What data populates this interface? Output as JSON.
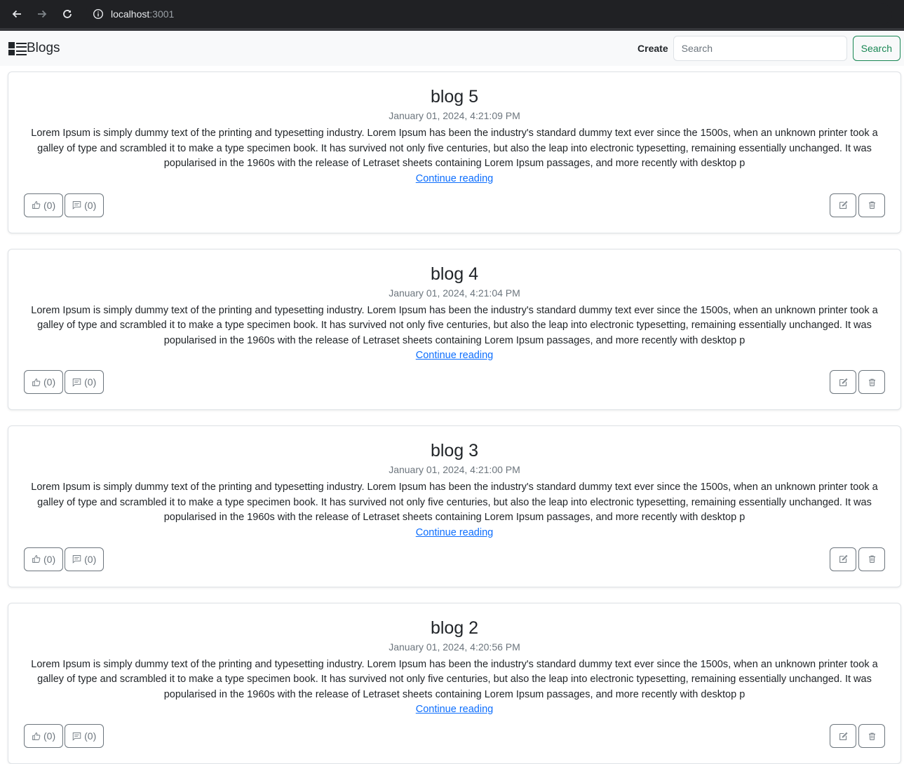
{
  "browser": {
    "url_host": "localhost",
    "url_port": ":3001",
    "icons": [
      "back-icon",
      "forward-icon",
      "reload-icon",
      "info-icon"
    ]
  },
  "navbar": {
    "brand": "Blogs",
    "create_label": "Create",
    "search_placeholder": "Search",
    "search_button": "Search",
    "colors": {
      "search_accent": "#198754",
      "link": "#0d6efd"
    }
  },
  "posts": [
    {
      "title": "blog 5",
      "date": "January 01, 2024, 4:21:09 PM",
      "excerpt": "Lorem Ipsum is simply dummy text of the printing and typesetting industry. Lorem Ipsum has been the industry's standard dummy text ever since the 1500s, when an unknown printer took a galley of type and scrambled it to make a type specimen book. It has survived not only five centuries, but also the leap into electronic typesetting, remaining essentially unchanged. It was popularised in the 1960s with the release of Letraset sheets containing Lorem Ipsum passages, and more recently with desktop p",
      "link": "Continue reading",
      "likes": "(0)",
      "comments": "(0)"
    },
    {
      "title": "blog 4",
      "date": "January 01, 2024, 4:21:04 PM",
      "excerpt": "Lorem Ipsum is simply dummy text of the printing and typesetting industry. Lorem Ipsum has been the industry's standard dummy text ever since the 1500s, when an unknown printer took a galley of type and scrambled it to make a type specimen book. It has survived not only five centuries, but also the leap into electronic typesetting, remaining essentially unchanged. It was popularised in the 1960s with the release of Letraset sheets containing Lorem Ipsum passages, and more recently with desktop p",
      "link": "Continue reading",
      "likes": "(0)",
      "comments": "(0)"
    },
    {
      "title": "blog 3",
      "date": "January 01, 2024, 4:21:00 PM",
      "excerpt": "Lorem Ipsum is simply dummy text of the printing and typesetting industry. Lorem Ipsum has been the industry's standard dummy text ever since the 1500s, when an unknown printer took a galley of type and scrambled it to make a type specimen book. It has survived not only five centuries, but also the leap into electronic typesetting, remaining essentially unchanged. It was popularised in the 1960s with the release of Letraset sheets containing Lorem Ipsum passages, and more recently with desktop p",
      "link": "Continue reading",
      "likes": "(0)",
      "comments": "(0)"
    },
    {
      "title": "blog 2",
      "date": "January 01, 2024, 4:20:56 PM",
      "excerpt": "Lorem Ipsum is simply dummy text of the printing and typesetting industry. Lorem Ipsum has been the industry's standard dummy text ever since the 1500s, when an unknown printer took a galley of type and scrambled it to make a type specimen book. It has survived not only five centuries, but also the leap into electronic typesetting, remaining essentially unchanged. It was popularised in the 1960s with the release of Letraset sheets containing Lorem Ipsum passages, and more recently with desktop p",
      "link": "Continue reading",
      "likes": "(0)",
      "comments": "(0)"
    }
  ]
}
